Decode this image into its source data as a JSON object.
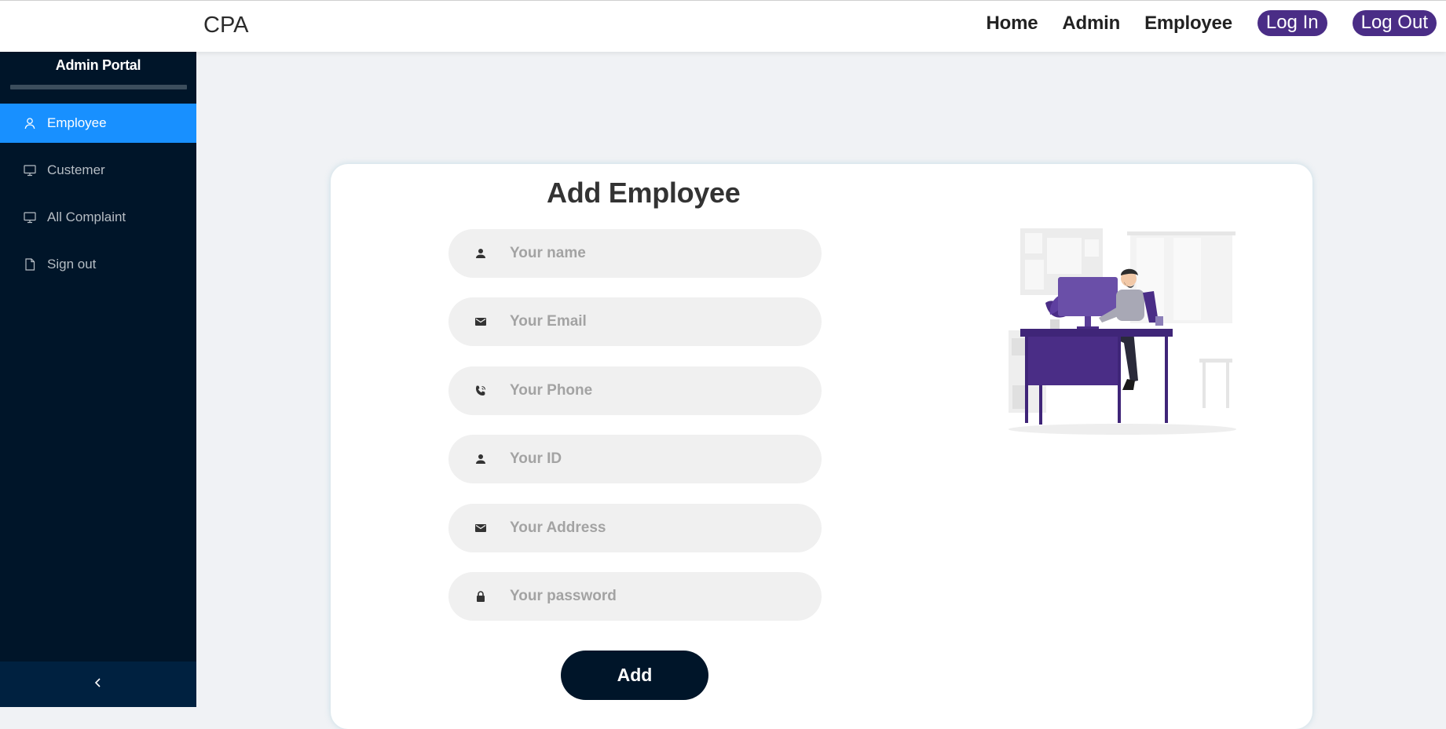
{
  "header": {
    "brand": "CPA",
    "nav": [
      {
        "label": "Home"
      },
      {
        "label": "Admin"
      },
      {
        "label": "Employee"
      }
    ],
    "login_label": "Log In",
    "logout_label": "Log Out",
    "pill_color": "#4a2d86"
  },
  "sidebar": {
    "title": "Admin Portal",
    "items": [
      {
        "label": "Employee",
        "icon": "user-icon",
        "active": true
      },
      {
        "label": "Custemer",
        "icon": "desktop-icon",
        "active": false
      },
      {
        "label": "All Complaint",
        "icon": "desktop-icon",
        "active": false
      },
      {
        "label": "Sign out",
        "icon": "file-icon",
        "active": false
      }
    ],
    "collapse_icon": "chevron-left-icon",
    "background": "#001529",
    "active_color": "#1890ff"
  },
  "form": {
    "title": "Add Employee",
    "fields": [
      {
        "placeholder": "Your name",
        "value": "",
        "icon": "person-icon"
      },
      {
        "placeholder": "Your Email",
        "value": "",
        "icon": "mail-icon"
      },
      {
        "placeholder": "Your Phone",
        "value": "",
        "icon": "phone-icon"
      },
      {
        "placeholder": "Your ID",
        "value": "",
        "icon": "person-icon"
      },
      {
        "placeholder": "Your Address",
        "value": "",
        "icon": "mail-icon"
      },
      {
        "placeholder": "Your password",
        "value": "",
        "icon": "lock-icon"
      }
    ],
    "submit_label": "Add"
  }
}
